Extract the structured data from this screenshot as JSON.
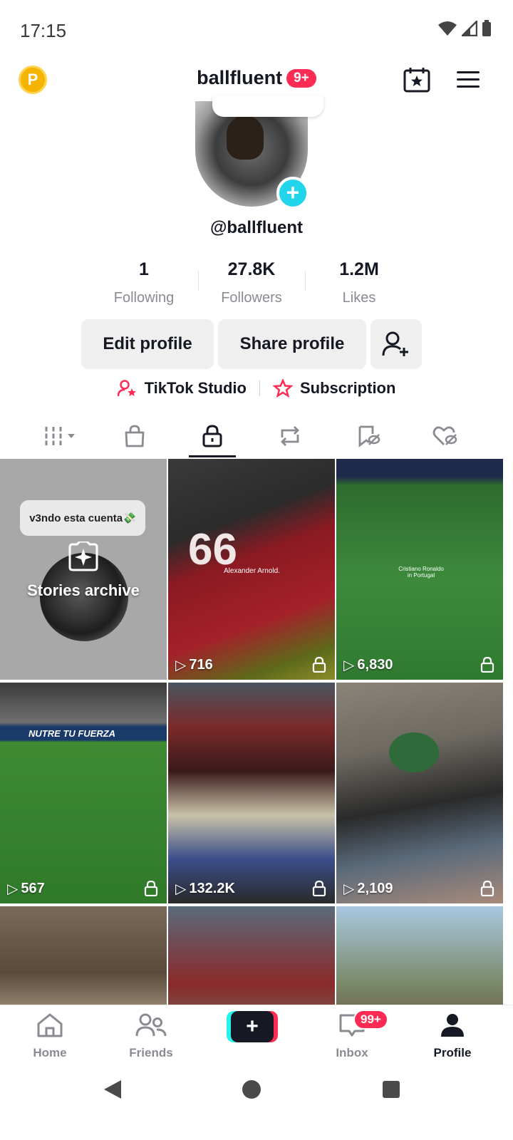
{
  "status_bar": {
    "time": "17:15"
  },
  "header": {
    "title": "ballfluent",
    "badge": "9+",
    "coin_letter": "P"
  },
  "profile": {
    "handle": "@ballfluent"
  },
  "stats": [
    {
      "value": "1",
      "label": "Following"
    },
    {
      "value": "27.8K",
      "label": "Followers"
    },
    {
      "value": "1.2M",
      "label": "Likes"
    }
  ],
  "buttons": {
    "edit": "Edit profile",
    "share": "Share profile"
  },
  "links": {
    "studio": "TikTok Studio",
    "subscription": "Subscription"
  },
  "tabs": [
    "videos-grid",
    "shop",
    "private",
    "reposts",
    "favorites",
    "liked"
  ],
  "archive": {
    "bubble": "v3ndo esta cuenta💸",
    "label": "Stories archive"
  },
  "videos": [
    {
      "views": "716",
      "caption": "Alexander Arnold."
    },
    {
      "views": "6,830",
      "caption": "Cristiano Ronaldo in Portugal"
    },
    {
      "views": "567",
      "caption": "NUTRE TU FUERZA"
    },
    {
      "views": "132.2K",
      "caption": ""
    },
    {
      "views": "2,109",
      "caption": ""
    }
  ],
  "nav": {
    "home": "Home",
    "friends": "Friends",
    "inbox": "Inbox",
    "inbox_badge": "99+",
    "profile": "Profile"
  },
  "colors": {
    "accent": "#fe2c55",
    "cyan": "#25f4ee",
    "avatar_plus": "#20d5ec"
  }
}
